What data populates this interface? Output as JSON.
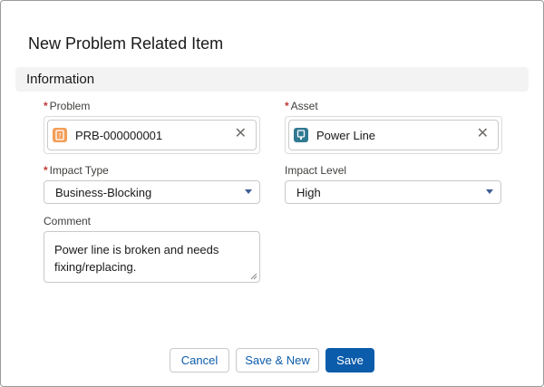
{
  "modal": {
    "title": "New Problem Related Item"
  },
  "section": {
    "title": "Information"
  },
  "problem": {
    "label": "Problem",
    "required_mark": "*",
    "value": "PRB-000000001",
    "icon": "problem-icon",
    "icon_color": "#f39e58",
    "clear_glyph": "✕"
  },
  "asset": {
    "label": "Asset",
    "required_mark": "*",
    "value": "Power Line",
    "icon": "asset-icon",
    "icon_color": "#317992",
    "clear_glyph": "✕"
  },
  "impact_type": {
    "label": "Impact Type",
    "required_mark": "*",
    "value": "Business-Blocking"
  },
  "impact_level": {
    "label": "Impact Level",
    "value": "High"
  },
  "comment": {
    "label": "Comment",
    "value": "Power line is broken and needs fixing/replacing."
  },
  "footer": {
    "cancel_label": "Cancel",
    "save_new_label": "Save & New",
    "save_label": "Save"
  },
  "colors": {
    "brand": "#0b5cab",
    "required": "#c23934",
    "section_bg": "#f3f3f3"
  }
}
